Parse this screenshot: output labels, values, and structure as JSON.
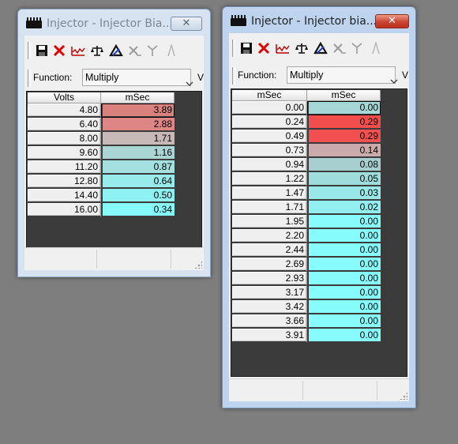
{
  "windows": [
    {
      "id": "win1",
      "title": "Injector - Injector Bia...",
      "close_label": "✕",
      "function_label": "Function:",
      "function_value": "Multiply",
      "function_trail": "V",
      "table": {
        "headers": [
          "Volts",
          "mSec"
        ],
        "rows": [
          {
            "key": "4.80",
            "value": "3.89",
            "color": "#d8817d"
          },
          {
            "key": "6.40",
            "value": "2.88",
            "color": "#de8585"
          },
          {
            "key": "8.00",
            "value": "1.71",
            "color": "#c8b9b9"
          },
          {
            "key": "9.60",
            "value": "1.16",
            "color": "#a9d5d5"
          },
          {
            "key": "11.20",
            "value": "0.87",
            "color": "#a4e0e0"
          },
          {
            "key": "12.80",
            "value": "0.64",
            "color": "#98ebeb"
          },
          {
            "key": "14.40",
            "value": "0.50",
            "color": "#8ff2f2"
          },
          {
            "key": "16.00",
            "value": "0.34",
            "color": "#87fbfb"
          }
        ]
      }
    },
    {
      "id": "win2",
      "title": "Injector - Injector bia...",
      "close_label": "✕",
      "function_label": "Function:",
      "function_value": "Multiply",
      "function_trail": "V",
      "table": {
        "headers": [
          "mSec",
          "mSec"
        ],
        "rows": [
          {
            "key": "0.00",
            "value": "0.00",
            "color": "#a6d7d7"
          },
          {
            "key": "0.24",
            "value": "0.29",
            "color": "#f24e4e"
          },
          {
            "key": "0.49",
            "value": "0.29",
            "color": "#f25050"
          },
          {
            "key": "0.73",
            "value": "0.14",
            "color": "#caaaaa"
          },
          {
            "key": "0.94",
            "value": "0.08",
            "color": "#a8cfcf"
          },
          {
            "key": "1.22",
            "value": "0.05",
            "color": "#9fdcdc"
          },
          {
            "key": "1.47",
            "value": "0.03",
            "color": "#98e8e8"
          },
          {
            "key": "1.71",
            "value": "0.02",
            "color": "#93f0f0"
          },
          {
            "key": "1.95",
            "value": "0.00",
            "color": "#86fcfc"
          },
          {
            "key": "2.20",
            "value": "0.00",
            "color": "#86fcfc"
          },
          {
            "key": "2.44",
            "value": "0.00",
            "color": "#86fcfc"
          },
          {
            "key": "2.69",
            "value": "0.00",
            "color": "#86fcfc"
          },
          {
            "key": "2.93",
            "value": "0.00",
            "color": "#86fcfc"
          },
          {
            "key": "3.17",
            "value": "0.00",
            "color": "#86fcfc"
          },
          {
            "key": "3.42",
            "value": "0.00",
            "color": "#86fcfc"
          },
          {
            "key": "3.66",
            "value": "0.00",
            "color": "#86fcfc"
          },
          {
            "key": "3.91",
            "value": "0.00",
            "color": "#86fcfc"
          }
        ]
      }
    }
  ],
  "toolbar_icons": [
    "save-icon",
    "delete-icon",
    "graph-icon",
    "balance-icon",
    "delta-icon",
    "scale-icon",
    "split-icon"
  ],
  "colors": {
    "desktop": "#7e7e7e",
    "grid_bg": "#3b3b3b",
    "close_active": "#c9432f"
  }
}
